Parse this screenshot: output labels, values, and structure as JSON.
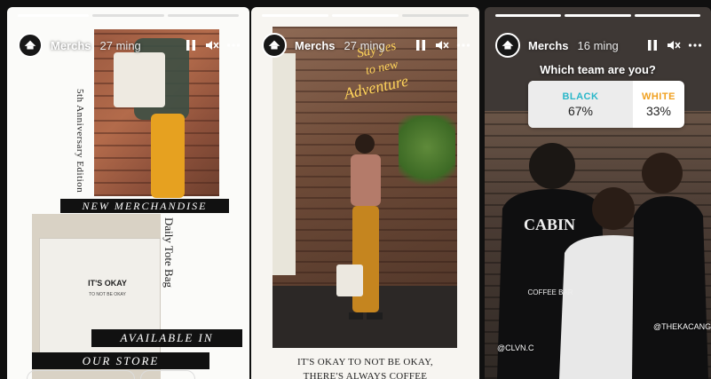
{
  "stories": [
    {
      "username": "Merchs",
      "time": "27 ming",
      "vertical_1": "5th Anniversary Edition",
      "banner_1": "NEW MERCHANDISE",
      "vertical_2": "Daily Tote Bag",
      "tote_print": [
        "IT'S OKAY",
        "TO NOT BE OKAY"
      ],
      "banner_2": "AVAILABLE IN",
      "banner_3": "OUR STORE"
    },
    {
      "username": "Merchs",
      "time": "27 ming",
      "neon_1": "Say yes",
      "neon_2": "to new",
      "neon_3": "Adventure",
      "caption_1": "IT'S OKAY TO NOT BE OKAY,",
      "caption_2": "THERE'S ALWAYS COFFEE"
    },
    {
      "username": "Merchs",
      "time": "16 ming",
      "question": "Which team are you?",
      "poll": {
        "option_a": {
          "label": "BLACK",
          "percent": "67%",
          "value": 67
        },
        "option_b": {
          "label": "WHITE",
          "percent": "33%",
          "value": 33
        }
      },
      "shirt_logo": "CABIN",
      "shirt_sub": "COFFEE BAR",
      "handle_1": "@CLVN.C",
      "handle_2": "@THEKACANGKU"
    }
  ],
  "colors": {
    "black_label": "#2ab7c9",
    "white_label": "#f0a020",
    "progress_active": "#ffffff",
    "progress_inactive": "#c8c8c8"
  }
}
